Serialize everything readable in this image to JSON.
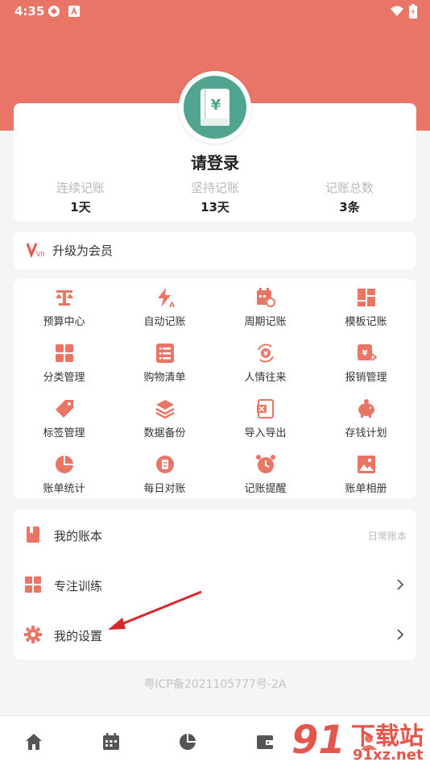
{
  "status_bar": {
    "time": "4:35"
  },
  "profile": {
    "login_label": "请登录",
    "stats": [
      {
        "label": "连续记账",
        "value": "1天"
      },
      {
        "label": "坚持记账",
        "value": "13天"
      },
      {
        "label": "记账总数",
        "value": "3条"
      }
    ],
    "avatar_symbol": "¥"
  },
  "vip": {
    "badge": "VIP",
    "label": "升级为会员"
  },
  "grid": {
    "items": [
      {
        "label": "预算中心",
        "icon": "scale-icon"
      },
      {
        "label": "自动记账",
        "icon": "lightning-icon"
      },
      {
        "label": "周期记账",
        "icon": "calendar-cycle-icon"
      },
      {
        "label": "模板记账",
        "icon": "template-icon"
      },
      {
        "label": "分类管理",
        "icon": "category-icon"
      },
      {
        "label": "购物清单",
        "icon": "list-icon"
      },
      {
        "label": "人情往来",
        "icon": "exchange-icon"
      },
      {
        "label": "报销管理",
        "icon": "reimburse-icon"
      },
      {
        "label": "标签管理",
        "icon": "tag-icon"
      },
      {
        "label": "数据备份",
        "icon": "layers-icon"
      },
      {
        "label": "导入导出",
        "icon": "import-export-icon"
      },
      {
        "label": "存钱计划",
        "icon": "piggy-bank-icon"
      },
      {
        "label": "账单统计",
        "icon": "pie-chart-icon"
      },
      {
        "label": "每日对账",
        "icon": "daily-check-icon"
      },
      {
        "label": "记账提醒",
        "icon": "alarm-icon"
      },
      {
        "label": "账单相册",
        "icon": "photo-icon"
      }
    ]
  },
  "menu": {
    "my_book": {
      "label": "我的账本",
      "value": "日常账本"
    },
    "focus": {
      "label": "专注训练"
    },
    "settings": {
      "label": "我的设置"
    }
  },
  "footer": {
    "icp": "粤ICP备2021105777号-2A"
  },
  "watermark": {
    "digits": "91",
    "text": "下载站",
    "url": "91xz.net"
  },
  "colors": {
    "accent": "#e97566",
    "avatar": "#4fa58f",
    "arrow": "#d9262b"
  }
}
